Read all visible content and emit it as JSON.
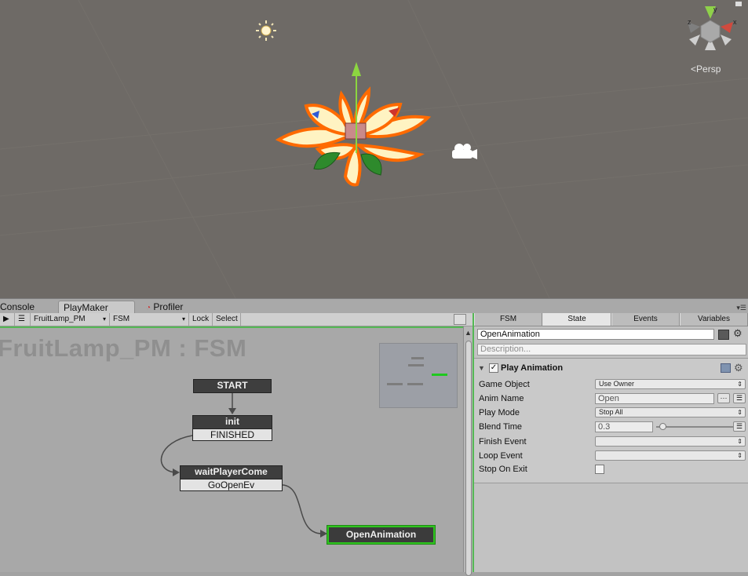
{
  "scene": {
    "projection_label": "Persp",
    "gizmo_axes": [
      "x",
      "y",
      "z"
    ]
  },
  "tabs": [
    {
      "label": "Console",
      "active": false
    },
    {
      "label": "PlayMaker",
      "active": true
    },
    {
      "label": "Profiler",
      "active": false,
      "icon": "profiler-icon"
    }
  ],
  "toolbar": {
    "play_icon": "play-icon",
    "menu_icon": "hamburger-menu-icon",
    "gameobject_dropdown": "FruitLamp_PM",
    "fsm_dropdown": "FSM",
    "lock_label": "Lock",
    "select_label": "Select"
  },
  "graph": {
    "title": "FruitLamp_PM : FSM",
    "states": [
      {
        "name": "START",
        "events": []
      },
      {
        "name": "init",
        "events": [
          "FINISHED"
        ]
      },
      {
        "name": "waitPlayerCome",
        "events": [
          "GoOpenEv"
        ]
      },
      {
        "name": "OpenAnimation",
        "events": [],
        "selected": true
      }
    ],
    "selected_color": "#2fc41f"
  },
  "inspector": {
    "tabs": [
      "FSM",
      "State",
      "Events",
      "Variables"
    ],
    "active_tab": "State",
    "state_name": "OpenAnimation",
    "description_placeholder": "Description...",
    "action": {
      "title": "Play Animation",
      "enabled": true,
      "params": [
        {
          "label": "Game Object",
          "type": "dropdown",
          "value": "Use Owner"
        },
        {
          "label": "Anim Name",
          "type": "text",
          "value": "Open"
        },
        {
          "label": "Play Mode",
          "type": "dropdown",
          "value": "Stop All"
        },
        {
          "label": "Blend Time",
          "type": "slider",
          "value": "0.3"
        },
        {
          "label": "Finish Event",
          "type": "dropdown",
          "value": ""
        },
        {
          "label": "Loop Event",
          "type": "dropdown",
          "value": ""
        },
        {
          "label": "Stop On Exit",
          "type": "checkbox",
          "value": false
        }
      ]
    }
  }
}
